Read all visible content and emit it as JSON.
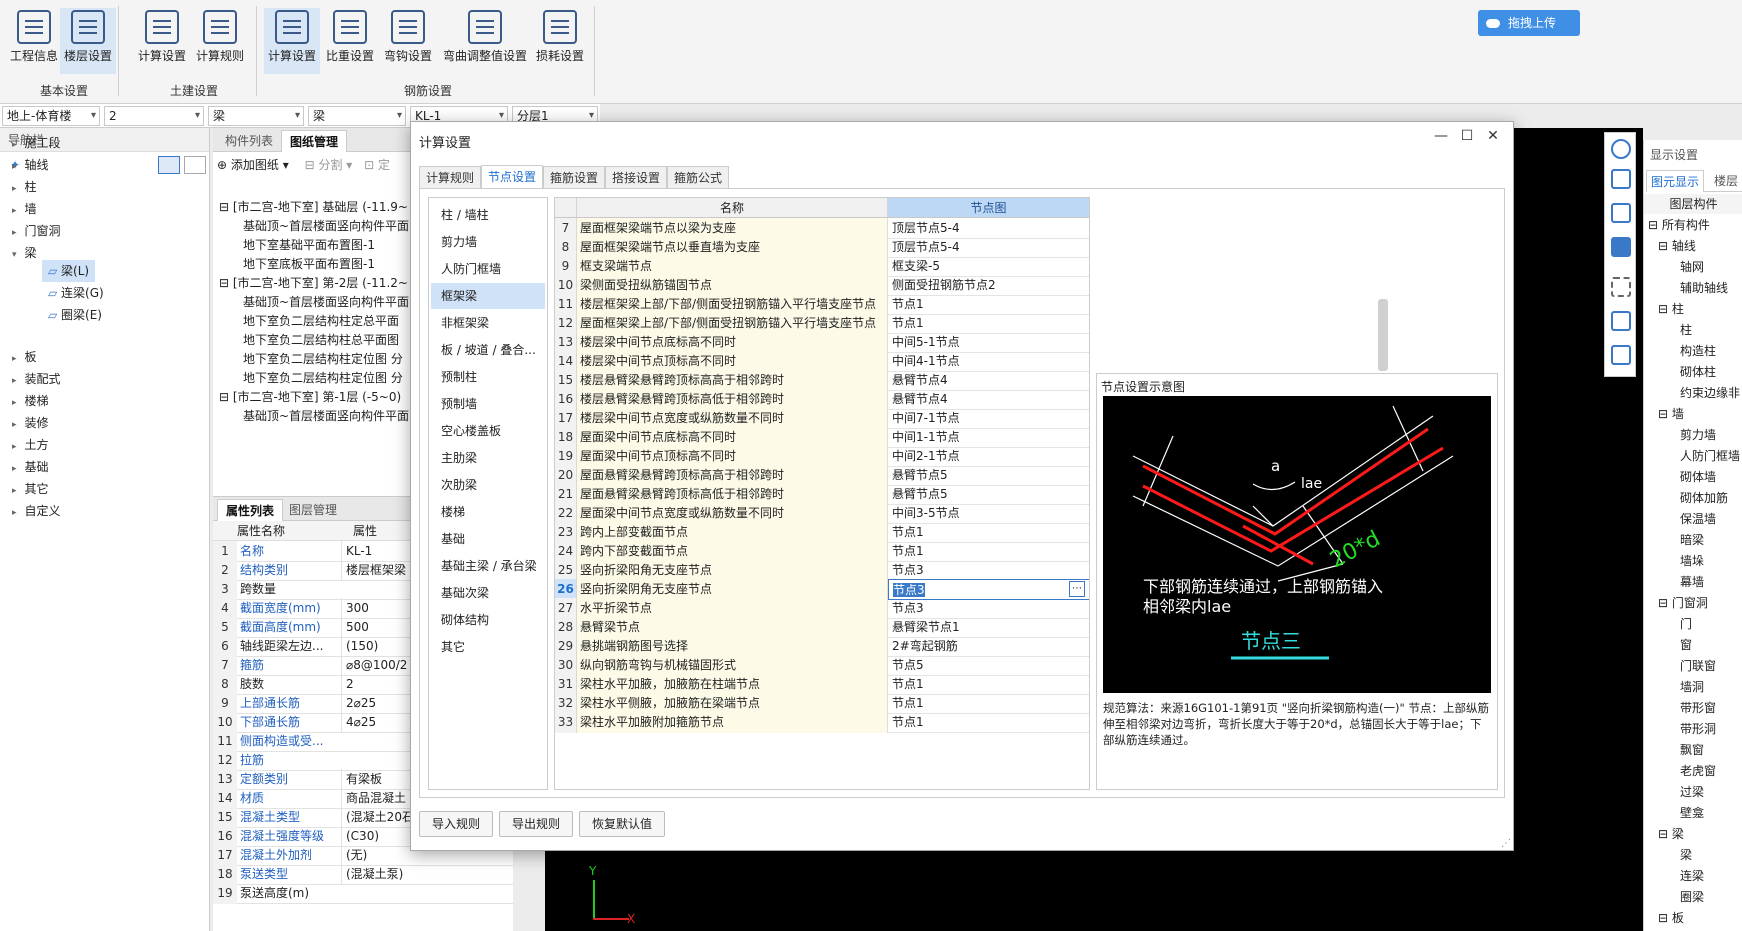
{
  "ribbon": {
    "buttons": [
      "工程信息",
      "楼层设置",
      "计算设置",
      "计算规则",
      "计算设置",
      "比重设置",
      "弯钩设置",
      "弯曲调整值设置",
      "损耗设置"
    ],
    "groups": [
      "基本设置",
      "土建设置",
      "钢筋设置"
    ],
    "upload_label": "拖拽上传"
  },
  "combos": [
    "地上-体育楼",
    "2",
    "梁",
    "梁",
    "KL-1",
    "分层1"
  ],
  "nav": {
    "title": "导航栏",
    "items": [
      "施工段",
      "轴线",
      "柱",
      "墙",
      "门窗洞",
      "梁",
      "板",
      "装配式",
      "楼梯",
      "装修",
      "土方",
      "基础",
      "其它",
      "自定义"
    ],
    "beam_children": [
      "梁(L)",
      "连梁(G)",
      "圈梁(E)"
    ]
  },
  "mid": {
    "tabs": [
      "构件列表",
      "图纸管理"
    ],
    "toolbar": [
      "添加图纸",
      "分割",
      "定"
    ],
    "tree": [
      "[市二宫-地下室] 基础层 (-11.9~",
      "基础顶~首层楼面竖向构件平面",
      "地下室基础平面布置图-1",
      "地下室底板平面布置图-1",
      "[市二宫-地下室] 第-2层 (-11.2~",
      "基础顶~首层楼面竖向构件平面",
      "地下室负二层结构柱定总平面",
      "地下室负二层结构柱总平面图",
      "地下室负二层结构柱定位图 分",
      "地下室负二层结构柱定位图 分",
      "[市二宫-地下室] 第-1层 (-5~0)",
      "基础顶~首层楼面竖向构件平面"
    ]
  },
  "props": {
    "tabs": [
      "属性列表",
      "图层管理"
    ],
    "headers": [
      "属性名称",
      "属性"
    ],
    "rows": [
      {
        "n": "1",
        "k": "名称",
        "v": "KL-1"
      },
      {
        "n": "2",
        "k": "结构类别",
        "v": "楼层框架梁"
      },
      {
        "n": "3",
        "k": "跨数量",
        "v": ""
      },
      {
        "n": "4",
        "k": "截面宽度(mm)",
        "v": "300"
      },
      {
        "n": "5",
        "k": "截面高度(mm)",
        "v": "500"
      },
      {
        "n": "6",
        "k": "轴线距梁左边...",
        "v": "(150)"
      },
      {
        "n": "7",
        "k": "箍筋",
        "v": "⌀8@100/2"
      },
      {
        "n": "8",
        "k": "肢数",
        "v": "2"
      },
      {
        "n": "9",
        "k": "上部通长筋",
        "v": "2⌀25"
      },
      {
        "n": "10",
        "k": "下部通长筋",
        "v": "4⌀25"
      },
      {
        "n": "11",
        "k": "侧面构造或受...",
        "v": ""
      },
      {
        "n": "12",
        "k": "拉筋",
        "v": ""
      },
      {
        "n": "13",
        "k": "定额类别",
        "v": "有梁板"
      },
      {
        "n": "14",
        "k": "材质",
        "v": "商品混凝土"
      },
      {
        "n": "15",
        "k": "混凝土类型",
        "v": "(混凝土20石"
      },
      {
        "n": "16",
        "k": "混凝土强度等级",
        "v": "(C30)"
      },
      {
        "n": "17",
        "k": "混凝土外加剂",
        "v": "(无)"
      },
      {
        "n": "18",
        "k": "泵送类型",
        "v": "(混凝土泵)"
      },
      {
        "n": "19",
        "k": "泵送高度(m)",
        "v": ""
      }
    ]
  },
  "right": {
    "title": "显示设置",
    "tabs": [
      "图元显示",
      "楼层"
    ],
    "header": "图层构件",
    "items": [
      "所有构件",
      "轴线",
      "轴网",
      "辅助轴线",
      "柱",
      "柱",
      "构造柱",
      "砌体柱",
      "约束边缘非",
      "墙",
      "剪力墙",
      "人防门框墙",
      "砌体墙",
      "砌体加筋",
      "保温墙",
      "暗梁",
      "墙垛",
      "幕墙",
      "门窗洞",
      "门",
      "窗",
      "门联窗",
      "墙洞",
      "带形窗",
      "带形洞",
      "飘窗",
      "老虎窗",
      "过梁",
      "壁龛",
      "梁",
      "梁",
      "连梁",
      "圈梁",
      "板"
    ]
  },
  "dialog": {
    "title": "计算设置",
    "tabs": [
      "计算规则",
      "节点设置",
      "箍筋设置",
      "搭接设置",
      "箍筋公式"
    ],
    "categories": [
      "柱 / 墙柱",
      "剪力墙",
      "人防门框墙",
      "框架梁",
      "非框架梁",
      "板 / 坡道 / 叠合...",
      "预制柱",
      "预制墙",
      "空心楼盖板",
      "主肋梁",
      "次肋梁",
      "楼梯",
      "基础",
      "基础主梁 / 承台梁",
      "基础次梁",
      "砌体结构",
      "其它"
    ],
    "grid_headers": [
      "名称",
      "节点图"
    ],
    "rows": [
      {
        "n": "7",
        "name": "屋面框架梁端节点以梁为支座",
        "node": "顶层节点5-4"
      },
      {
        "n": "8",
        "name": "屋面框架梁端节点以垂直墙为支座",
        "node": "顶层节点5-4"
      },
      {
        "n": "9",
        "name": "框支梁端节点",
        "node": "框支梁-5"
      },
      {
        "n": "10",
        "name": "梁侧面受扭纵筋锚固节点",
        "node": "侧面受扭钢筋节点2"
      },
      {
        "n": "11",
        "name": "楼层框架梁上部/下部/侧面受扭钢筋锚入平行墙支座节点",
        "node": "节点1"
      },
      {
        "n": "12",
        "name": "屋面框架梁上部/下部/侧面受扭钢筋锚入平行墙支座节点",
        "node": "节点1"
      },
      {
        "n": "13",
        "name": "楼层梁中间节点底标高不同时",
        "node": "中间5-1节点"
      },
      {
        "n": "14",
        "name": "楼层梁中间节点顶标高不同时",
        "node": "中间4-1节点"
      },
      {
        "n": "15",
        "name": "楼层悬臂梁悬臂跨顶标高高于相邻跨时",
        "node": "悬臂节点4"
      },
      {
        "n": "16",
        "name": "楼层悬臂梁悬臂跨顶标高低于相邻跨时",
        "node": "悬臂节点4"
      },
      {
        "n": "17",
        "name": "楼层梁中间节点宽度或纵筋数量不同时",
        "node": "中间7-1节点"
      },
      {
        "n": "18",
        "name": "屋面梁中间节点底标高不同时",
        "node": "中间1-1节点"
      },
      {
        "n": "19",
        "name": "屋面梁中间节点顶标高不同时",
        "node": "中间2-1节点"
      },
      {
        "n": "20",
        "name": "屋面悬臂梁悬臂跨顶标高高于相邻跨时",
        "node": "悬臂节点5"
      },
      {
        "n": "21",
        "name": "屋面悬臂梁悬臂跨顶标高低于相邻跨时",
        "node": "悬臂节点5"
      },
      {
        "n": "22",
        "name": "屋面梁中间节点宽度或纵筋数量不同时",
        "node": "中间3-5节点"
      },
      {
        "n": "23",
        "name": "跨内上部变截面节点",
        "node": "节点1"
      },
      {
        "n": "24",
        "name": "跨内下部变截面节点",
        "node": "节点1"
      },
      {
        "n": "25",
        "name": "竖向折梁阳角无支座节点",
        "node": "节点3"
      },
      {
        "n": "26",
        "name": "竖向折梁阴角无支座节点",
        "node": "节点3"
      },
      {
        "n": "27",
        "name": "水平折梁节点",
        "node": "节点3"
      },
      {
        "n": "28",
        "name": "悬臂梁节点",
        "node": "悬臂梁节点1"
      },
      {
        "n": "29",
        "name": "悬挑端钢筋图号选择",
        "node": "2#弯起钢筋"
      },
      {
        "n": "30",
        "name": "纵向钢筋弯钩与机械锚固形式",
        "node": "节点5"
      },
      {
        "n": "31",
        "name": "梁柱水平加腋，加腋筋在柱端节点",
        "node": "节点1"
      },
      {
        "n": "32",
        "name": "梁柱水平侧腋，加腋筋在梁端节点",
        "node": "节点1"
      },
      {
        "n": "33",
        "name": "梁柱水平加腋附加箍筋节点",
        "node": "节点1"
      }
    ],
    "preview_title": "节点设置示意图",
    "diagram": {
      "label_a": "a",
      "label_lae": "lae",
      "label_20d": "20*d",
      "text_line1": "下部钢筋连续通过，上部钢筋锚入",
      "text_line2": "相邻梁内lae",
      "caption": "节点三"
    },
    "preview_desc": "规范算法：来源16G101-1第91页 \"竖向折梁钢筋构造(一)\" 节点：上部纵筋伸至相邻梁对边弯折，弯折长度大于等于20*d，总锚固长大于等于lae；下部纵筋连续通过。",
    "buttons": [
      "导入规则",
      "导出规则",
      "恢复默认值"
    ]
  },
  "canvas": {
    "axis_x": "X",
    "axis_y": "Y"
  },
  "colors": {
    "accent": "#1f6fd0",
    "selected_bg": "#cfe2f8",
    "diagram_red": "#ff1a1a",
    "diagram_green": "#22dd22",
    "diagram_cyan": "#33dddd"
  }
}
